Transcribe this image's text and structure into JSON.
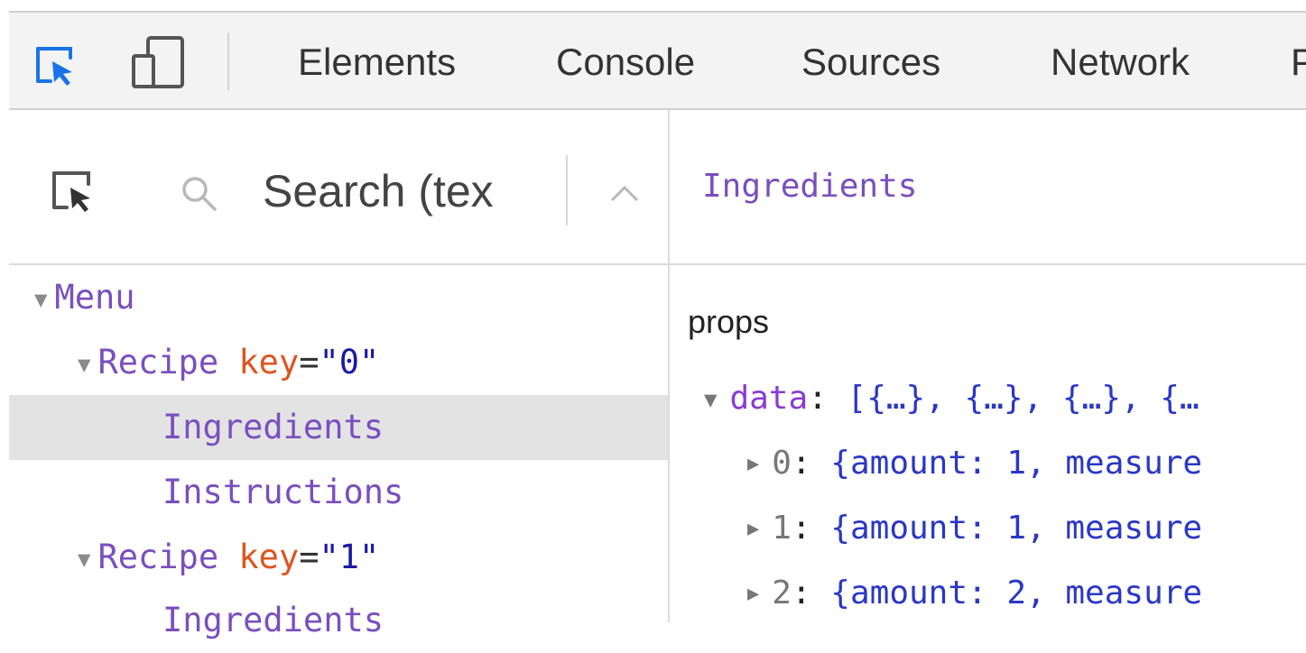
{
  "toolbar": {
    "tabs": [
      "Elements",
      "Console",
      "Sources",
      "Network",
      "P"
    ]
  },
  "left_panel": {
    "search_placeholder": "Search (tex",
    "tree": [
      {
        "name": "Menu",
        "expanded": true
      },
      {
        "name": "Recipe",
        "attr": "key",
        "value": "\"0\"",
        "expanded": true
      },
      {
        "name": "Ingredients",
        "selected": true
      },
      {
        "name": "Instructions"
      },
      {
        "name": "Recipe",
        "attr": "key",
        "value": "\"1\"",
        "expanded": true
      },
      {
        "name": "Ingredients"
      }
    ]
  },
  "right_panel": {
    "title": "Ingredients",
    "props_label": "props",
    "data_row": {
      "key": "data",
      "value": "[{…}, {…}, {…}, {…"
    },
    "items": [
      {
        "index": "0",
        "value": "{amount: 1, measure"
      },
      {
        "index": "1",
        "value": "{amount: 1, measure"
      },
      {
        "index": "2",
        "value": "{amount: 2, measure"
      }
    ]
  },
  "colors": {
    "component": "#7a4fbf",
    "attribute": "#e0541f",
    "value": "#1a1aa6",
    "accent_icon": "#1a73e8"
  }
}
